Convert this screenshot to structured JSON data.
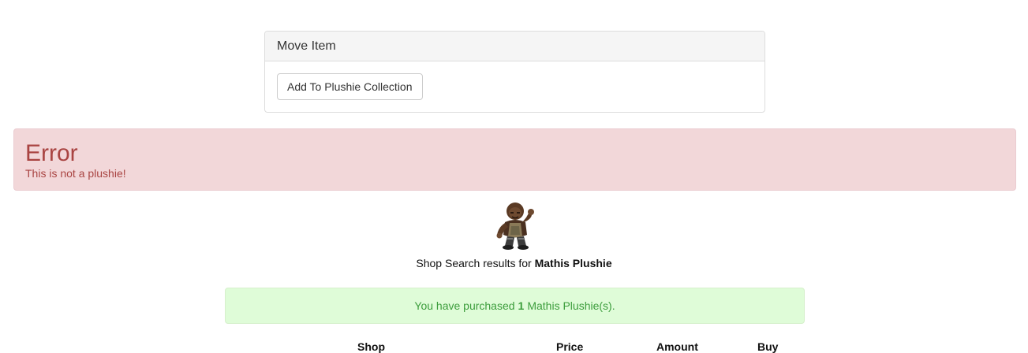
{
  "move_item": {
    "heading": "Move Item",
    "button_label": "Add To Plushie Collection"
  },
  "error": {
    "title": "Error",
    "message": "This is not a plushie!"
  },
  "search": {
    "prefix": "Shop Search results for ",
    "item_name": "Mathis Plushie"
  },
  "purchase": {
    "prefix": "You have purchased",
    "count": "1",
    "suffix": "Mathis Plushie(s)."
  },
  "table": {
    "headers": [
      "Shop",
      "Price",
      "Amount",
      "Buy"
    ]
  },
  "colors": {
    "error_bg": "#f2d7d9",
    "error_text": "#a94442",
    "success_bg": "#dffcd8",
    "success_text": "#3c9d3c"
  }
}
